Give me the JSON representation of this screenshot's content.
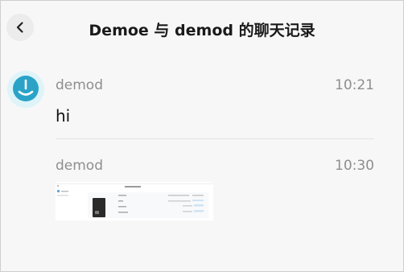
{
  "header": {
    "title": "Demoe 与 demod 的聊天记录"
  },
  "messages": [
    {
      "sender": "demod",
      "time": "10:21",
      "text": "hi"
    },
    {
      "sender": "demod",
      "time": "10:30",
      "attachment": "screenshot-image"
    }
  ],
  "colors": {
    "background": "#f7f7f7",
    "avatar_accent": "#2aa3c7",
    "meta_text": "#8e8e8e"
  }
}
